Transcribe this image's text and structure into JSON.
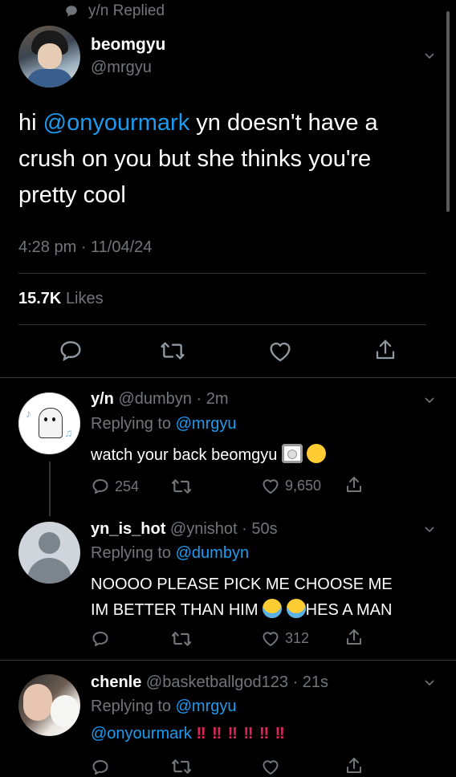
{
  "context": {
    "replied_label": "y/n Replied"
  },
  "main_tweet": {
    "display_name": "beomgyu",
    "handle": "@mrgyu",
    "text_prefix": "hi ",
    "mention": "@onyourmark",
    "text_rest": " yn doesn't have a crush on you but she thinks you're pretty cool",
    "timestamp": "4:28 pm · 11/04/24",
    "likes_count": "15.7K",
    "likes_label": "Likes"
  },
  "replies": [
    {
      "display_name": "y/n",
      "handle": "@dumbyn",
      "time": "· 2m",
      "replying_label": "Replying to",
      "replying_to": "@mrgyu",
      "text": "watch your back beomgyu",
      "reply_count": "254",
      "retweet_count": "",
      "like_count": "9,650"
    },
    {
      "display_name": "yn_is_hot",
      "handle": "@ynishot",
      "time": "· 50s",
      "replying_label": "Replying to",
      "replying_to": "@dumbyn",
      "text_line1": "NOOOO PLEASE PICK ME CHOOSE ME",
      "text_line2_a": "IM BETTER THAN HIM",
      "text_line2_b": "HES A MAN",
      "reply_count": "",
      "retweet_count": "",
      "like_count": "312"
    },
    {
      "display_name": "chenle",
      "handle": "@basketballgod123",
      "time": "· 21s",
      "replying_label": "Replying to",
      "replying_to": "@mrgyu",
      "mention": "@onyourmark",
      "bangs": "‼ ‼ ‼ ‼ ‼ ‼"
    }
  ],
  "icons": [
    "speech-bubble-icon",
    "chevron-down-icon",
    "reply-icon",
    "retweet-icon",
    "like-icon",
    "share-icon",
    "plate-emoji",
    "smile-emoji",
    "crying-emoji"
  ],
  "colors": {
    "background": "#000000",
    "link": "#1d9bf0",
    "muted": "#71767b",
    "divider": "#2f3336",
    "bang": "#e0245e"
  }
}
